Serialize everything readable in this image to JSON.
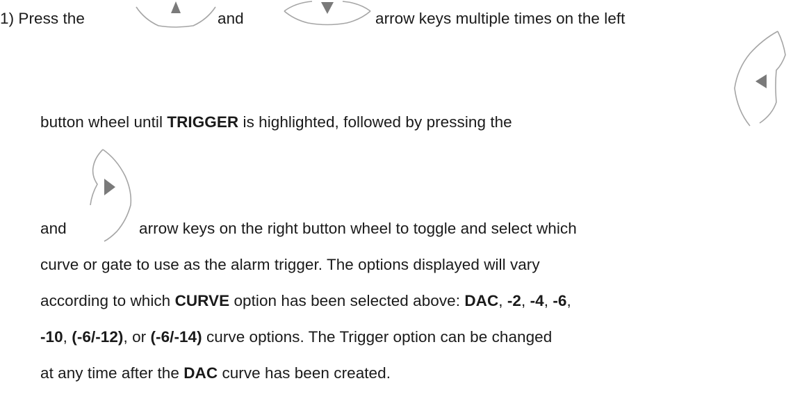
{
  "step": {
    "number": "1)",
    "press_the": "Press the",
    "and_1": "and",
    "arrow_keys_left": "arrow keys multiple times on the left",
    "button_wheel_until": "button wheel until",
    "trigger": "TRIGGER",
    "is_highlighted": "is highlighted, followed by pressing the",
    "and_2": "and",
    "arrow_keys_right": "arrow keys on the right button wheel to toggle and select which",
    "line4": "curve or gate to use as the alarm trigger.  The options displayed will vary",
    "according": "according to which",
    "curve": "CURVE",
    "option_selected": "option has been selected above:",
    "dac": "DAC",
    "comma": ",",
    "neg2": "-2",
    "neg4": "-4",
    "neg6": "-6",
    "neg10": "-10",
    "neg6_12": "(-6/-12)",
    "or": ", or",
    "neg6_14": "(-6/-14)",
    "curve_options": "curve options.  The Trigger option can be changed",
    "at_any_time": "at any time after the",
    "dac_2": "DAC",
    "curve_created": "curve has been created."
  },
  "icons": {
    "up_arrow_key": "up-arrow-key-icon",
    "down_arrow_key": "down-arrow-key-icon",
    "left_arrow_key": "left-arrow-key-icon",
    "right_arrow_key": "right-arrow-key-icon"
  },
  "colors": {
    "text": "#1a1a1a",
    "key_outline": "#9a9a9a",
    "key_arrow": "#7a7a7a"
  }
}
